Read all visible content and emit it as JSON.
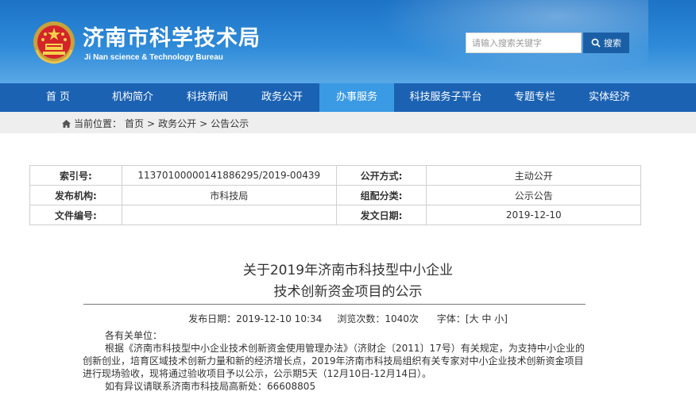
{
  "header": {
    "title": "济南市科学技术局",
    "subtitle": "Ji Nan science & Technology Bureau",
    "search_placeholder": "请输入搜索关键字",
    "search_button": "搜索"
  },
  "nav": {
    "items": [
      {
        "label": "首 页"
      },
      {
        "label": "机构简介"
      },
      {
        "label": "科技新闻"
      },
      {
        "label": "政务公开"
      },
      {
        "label": "办事服务"
      },
      {
        "label": "科技服务子平台"
      },
      {
        "label": "专题专栏"
      },
      {
        "label": "实体经济"
      }
    ],
    "active": "办事服务"
  },
  "breadcrumb": {
    "prefix": "当前位置：",
    "home": "首页",
    "section": "政务公开",
    "current": "公告公示",
    "sep": ">"
  },
  "meta": {
    "index_label": "索引号:",
    "index_value": "11370100000141886295/2019-00439",
    "open_mode_label": "公开方式:",
    "open_mode_value": "主动公开",
    "publisher_label": "发布机构:",
    "publisher_value": "市科技局",
    "category_label": "组配分类:",
    "category_value": "公示公告",
    "doc_no_label": "文件编号:",
    "doc_no_value": "",
    "issue_date_label": "发文日期:",
    "issue_date_value": "2019-12-10"
  },
  "article": {
    "title_line1": "关于2019年济南市科技型中小企业",
    "title_line2": "技术创新资金项目的公示",
    "publish_label": "发布日期：",
    "publish_value": "2019-12-10 10:34",
    "views_label": "浏览次数：",
    "views_value": "1040次",
    "font_label": "字体：",
    "font_open": "[",
    "font_large": "大",
    "font_medium": "中",
    "font_small": "小",
    "font_close": "]",
    "salutation": "各有关单位：",
    "para1": "根据《济南市科技型中小企业技术创新资金使用管理办法》（济财企〔2011〕17号）有关规定，为支持中小企业的创新创业，培育区域技术创新力量和新的经济增长点，2019年济南市科技局组织有关专家对中小企业技术创新资金项目进行现场验收，现将通过验收项目予以公示，公示期5天（12月10日-12月14日）。",
    "para2": "如有异议请联系济南市科技局高新处：66608805"
  },
  "colors": {
    "header_blue": "#1d73c6",
    "nav_blue": "#1b62b3",
    "nav_active": "#3a9ae4",
    "crumb_bg": "#eeeeee"
  }
}
